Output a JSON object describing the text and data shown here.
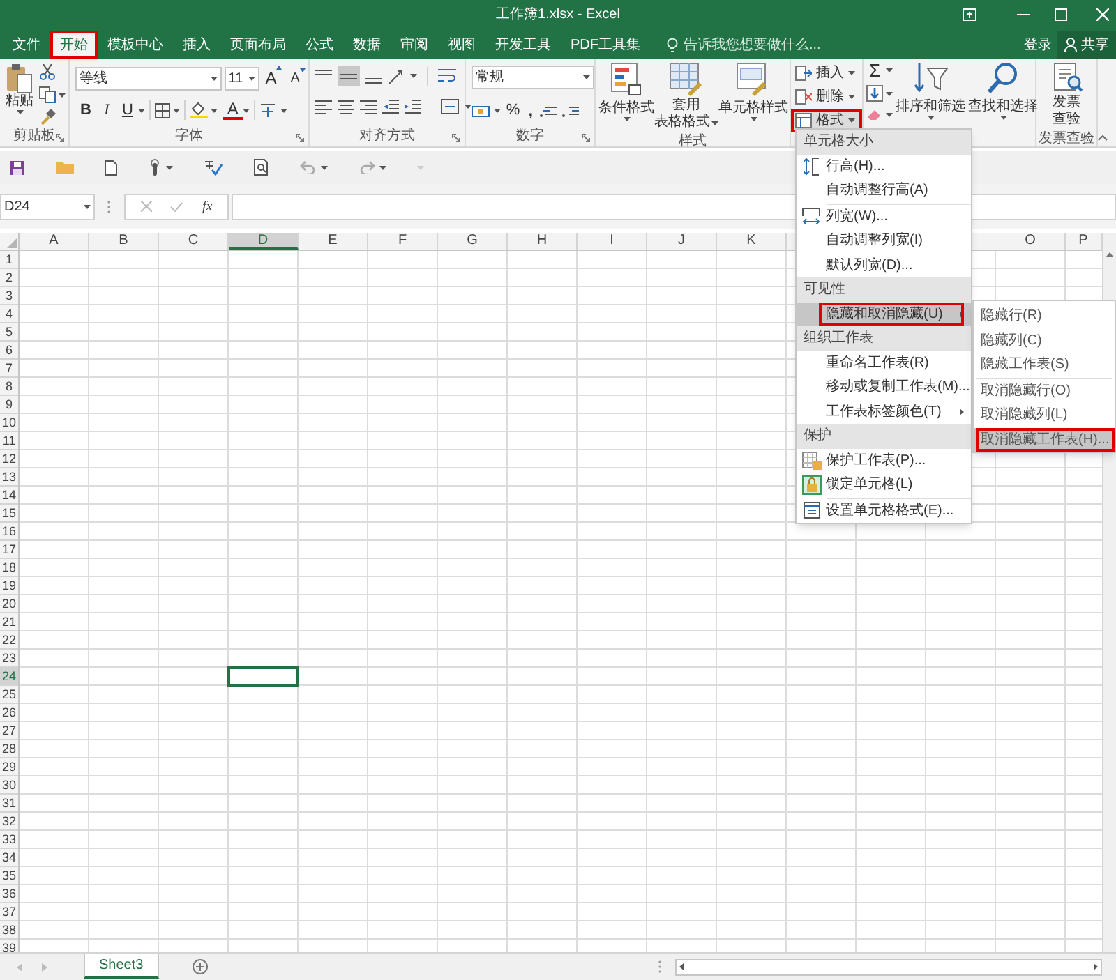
{
  "window": {
    "title": "工作簿1.xlsx - Excel"
  },
  "tabs": [
    {
      "label": "文件",
      "selected": false
    },
    {
      "label": "开始",
      "selected": true,
      "annotated": true
    },
    {
      "label": "模板中心",
      "selected": false
    },
    {
      "label": "插入",
      "selected": false
    },
    {
      "label": "页面布局",
      "selected": false
    },
    {
      "label": "公式",
      "selected": false
    },
    {
      "label": "数据",
      "selected": false
    },
    {
      "label": "审阅",
      "selected": false
    },
    {
      "label": "视图",
      "selected": false
    },
    {
      "label": "开发工具",
      "selected": false
    },
    {
      "label": "PDF工具集",
      "selected": false
    }
  ],
  "tell_me": {
    "placeholder": "告诉我您想要做什么..."
  },
  "sign_in": "登录",
  "share": "共享",
  "ribbon": {
    "clipboard": {
      "paste": "粘贴",
      "label": "剪贴板"
    },
    "font": {
      "name": "等线",
      "size": "11",
      "grow": "A",
      "shrink": "A",
      "bold": "B",
      "italic": "I",
      "underline": "U",
      "font_color": "A",
      "label": "字体"
    },
    "alignment": {
      "label": "对齐方式"
    },
    "number": {
      "format": "常规",
      "percent": "%",
      "comma": ",",
      "label": "数字"
    },
    "styles": {
      "conditional": "条件格式",
      "table_line_1": "套用",
      "table_line_2": "表格格式",
      "cell_styles": "单元格样式",
      "label": "样式"
    },
    "cells": {
      "insert": "插入",
      "delete": "删除",
      "format": "格式",
      "format_annotated": true
    },
    "editing": {
      "autosum": "Σ",
      "sort": "排序和筛选",
      "find": "查找和选择"
    },
    "invoice": {
      "line_1": "发票",
      "line_2": "查验",
      "label": "发票查验"
    }
  },
  "name_box": "D24",
  "fx": "fx",
  "columns": [
    {
      "label": "A",
      "selected": false
    },
    {
      "label": "B",
      "selected": false
    },
    {
      "label": "C",
      "selected": false
    },
    {
      "label": "D",
      "selected": true
    },
    {
      "label": "E",
      "selected": false
    },
    {
      "label": "F",
      "selected": false
    },
    {
      "label": "G",
      "selected": false
    },
    {
      "label": "H",
      "selected": false
    },
    {
      "label": "I",
      "selected": false
    },
    {
      "label": "J",
      "selected": false
    },
    {
      "label": "K",
      "selected": false
    },
    {
      "label": "O",
      "selected": false,
      "gap_before": true
    },
    {
      "label": "P",
      "selected": false
    }
  ],
  "rows": [
    {
      "label": "1",
      "selected": false
    },
    {
      "label": "2",
      "selected": false
    },
    {
      "label": "3",
      "selected": false
    },
    {
      "label": "4",
      "selected": false
    },
    {
      "label": "5",
      "selected": false
    },
    {
      "label": "6",
      "selected": false
    },
    {
      "label": "7",
      "selected": false
    },
    {
      "label": "8",
      "selected": false
    },
    {
      "label": "9",
      "selected": false
    },
    {
      "label": "10",
      "selected": false
    },
    {
      "label": "11",
      "selected": false
    },
    {
      "label": "12",
      "selected": false
    },
    {
      "label": "13",
      "selected": false
    },
    {
      "label": "14",
      "selected": false
    },
    {
      "label": "15",
      "selected": false
    },
    {
      "label": "16",
      "selected": false
    },
    {
      "label": "17",
      "selected": false
    },
    {
      "label": "18",
      "selected": false
    },
    {
      "label": "19",
      "selected": false
    },
    {
      "label": "20",
      "selected": false
    },
    {
      "label": "21",
      "selected": false
    },
    {
      "label": "22",
      "selected": false
    },
    {
      "label": "23",
      "selected": false
    },
    {
      "label": "24",
      "selected": true
    },
    {
      "label": "25",
      "selected": false
    },
    {
      "label": "26",
      "selected": false
    },
    {
      "label": "27",
      "selected": false
    },
    {
      "label": "28",
      "selected": false
    },
    {
      "label": "29",
      "selected": false
    },
    {
      "label": "30",
      "selected": false
    },
    {
      "label": "31",
      "selected": false
    },
    {
      "label": "32",
      "selected": false
    },
    {
      "label": "33",
      "selected": false
    },
    {
      "label": "34",
      "selected": false
    },
    {
      "label": "35",
      "selected": false
    },
    {
      "label": "36",
      "selected": false
    },
    {
      "label": "37",
      "selected": false
    },
    {
      "label": "38",
      "selected": false
    },
    {
      "label": "39",
      "selected": false
    }
  ],
  "sheets": [
    {
      "label": "Sheet3",
      "selected": true
    }
  ],
  "format_menu": [
    {
      "header": "单元格大小",
      "items": [
        {
          "label": "行高(H)...",
          "kind": "row_height",
          "selected": false
        },
        {
          "label": "自动调整行高(A)",
          "kind": "plain",
          "selected": false
        },
        {
          "label": "列宽(W)...",
          "kind": "column_width",
          "selected": false,
          "separator_before": true
        },
        {
          "label": "自动调整列宽(I)",
          "kind": "plain",
          "selected": false
        },
        {
          "label": "默认列宽(D)...",
          "kind": "plain",
          "selected": false
        }
      ]
    },
    {
      "header": "可见性",
      "items": [
        {
          "label": "隐藏和取消隐藏(U)",
          "kind": "plain",
          "selected": true,
          "submenu": true,
          "annotated": true
        }
      ]
    },
    {
      "header": "组织工作表",
      "items": [
        {
          "label": "重命名工作表(R)",
          "kind": "plain",
          "selected": false
        },
        {
          "label": "移动或复制工作表(M)...",
          "kind": "plain",
          "selected": false
        },
        {
          "label": "工作表标签颜色(T)",
          "kind": "plain",
          "selected": false,
          "submenu": true
        }
      ]
    },
    {
      "header": "保护",
      "items": [
        {
          "label": "保护工作表(P)...",
          "kind": "protect_sheet",
          "selected": false
        },
        {
          "label": "锁定单元格(L)",
          "kind": "lock_cells",
          "selected": false
        },
        {
          "label": "设置单元格格式(E)...",
          "kind": "format_cells",
          "selected": false,
          "separator_before": true
        }
      ]
    }
  ],
  "hide_submenu": [
    {
      "label": "隐藏行(R)",
      "selected": false
    },
    {
      "label": "隐藏列(C)",
      "selected": false
    },
    {
      "label": "隐藏工作表(S)",
      "selected": false
    },
    {
      "label": "取消隐藏行(O)",
      "selected": false,
      "separator_before": true
    },
    {
      "label": "取消隐藏列(L)",
      "selected": false
    },
    {
      "label": "取消隐藏工作表(H)...",
      "selected": true,
      "annotated": true
    }
  ]
}
